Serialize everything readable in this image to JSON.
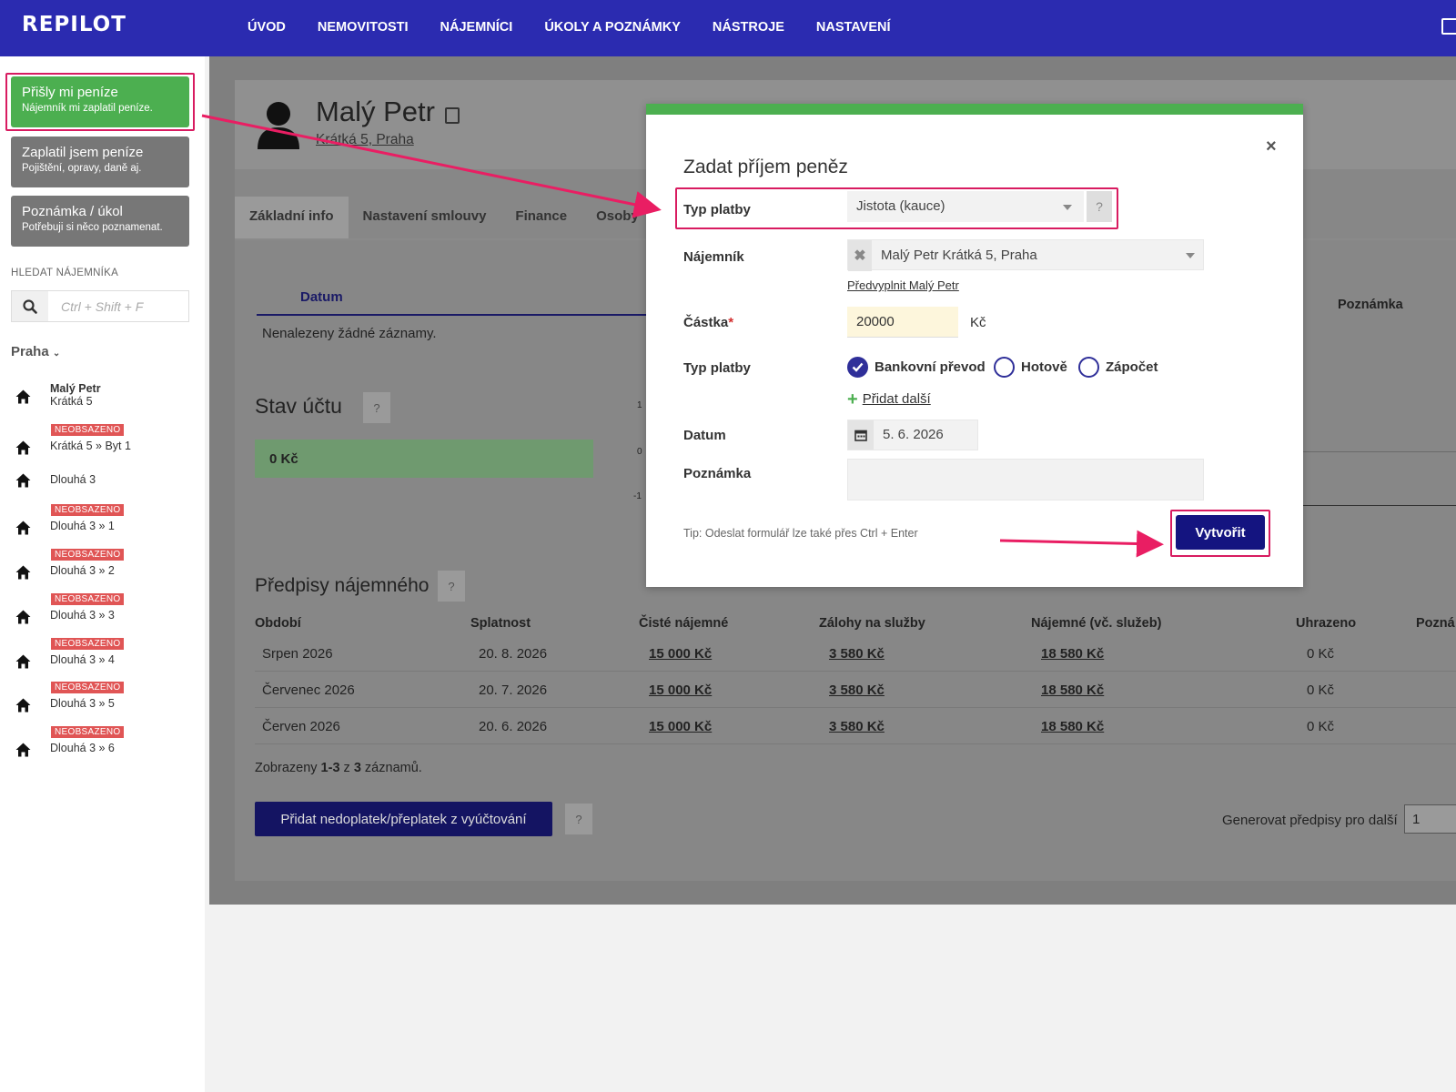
{
  "app": {
    "logo": "REPILOT",
    "nav": [
      "ÚVOD",
      "NEMOVITOSTI",
      "NÁJEMNÍCI",
      "ÚKOLY A POZNÁMKY",
      "NÁSTROJE",
      "NASTAVENÍ"
    ]
  },
  "sidebar": {
    "actions": [
      {
        "title": "Přišly mi peníze",
        "subtitle": "Nájemník mi zaplatil peníze."
      },
      {
        "title": "Zaplatil jsem peníze",
        "subtitle": "Pojištění, opravy, daně aj."
      },
      {
        "title": "Poznámka / úkol",
        "subtitle": "Potřebuji si něco poznamenat."
      }
    ],
    "search_label": "HLEDAT NÁJEMNÍKA",
    "search_placeholder": "Ctrl + Shift + F",
    "city": "Praha",
    "properties": [
      {
        "tenant": "Malý Petr",
        "name": "Krátká 5",
        "badge": ""
      },
      {
        "tenant": "",
        "name": "Krátká 5 » Byt 1",
        "badge": "NEOBSAZENO"
      },
      {
        "tenant": "",
        "name": "Dlouhá 3",
        "badge": ""
      },
      {
        "tenant": "",
        "name": "Dlouhá 3 » 1",
        "badge": "NEOBSAZENO"
      },
      {
        "tenant": "",
        "name": "Dlouhá 3 » 2",
        "badge": "NEOBSAZENO"
      },
      {
        "tenant": "",
        "name": "Dlouhá 3 » 3",
        "badge": "NEOBSAZENO"
      },
      {
        "tenant": "",
        "name": "Dlouhá 3 » 4",
        "badge": "NEOBSAZENO"
      },
      {
        "tenant": "",
        "name": "Dlouhá 3 » 5",
        "badge": "NEOBSAZENO"
      },
      {
        "tenant": "",
        "name": "Dlouhá 3 » 6",
        "badge": "NEOBSAZENO"
      }
    ]
  },
  "tenant": {
    "name": "Malý Petr",
    "address": "Krátká 5, Praha"
  },
  "tabs": [
    "Základní info",
    "Nastavení smlouvy",
    "Finance",
    "Osoby"
  ],
  "payments": {
    "date_header": "Datum",
    "note_header": "Poznámka",
    "empty": "Nenalezeny žádné záznamy."
  },
  "balance": {
    "title": "Stav účtu",
    "help": "?",
    "value": "0 Kč",
    "ticks": [
      "1",
      "0",
      "-1"
    ]
  },
  "rent": {
    "title": "Předpisy nájemného",
    "help": "?",
    "columns": [
      "Období",
      "Splatnost",
      "Čisté nájemné",
      "Zálohy na služby",
      "Nájemné (vč. služeb)",
      "Uhrazeno",
      "Pozná"
    ],
    "rows": [
      {
        "period": "Srpen 2026",
        "due": "20. 8. 2026",
        "net": "15 000 Kč",
        "services": "3 580 Kč",
        "total": "18 580 Kč",
        "paid": "0 Kč"
      },
      {
        "period": "Červenec 2026",
        "due": "20. 7. 2026",
        "net": "15 000 Kč",
        "services": "3 580 Kč",
        "total": "18 580 Kč",
        "paid": "0 Kč"
      },
      {
        "period": "Červen 2026",
        "due": "20. 6. 2026",
        "net": "15 000 Kč",
        "services": "3 580 Kč",
        "total": "18 580 Kč",
        "paid": "0 Kč"
      }
    ],
    "shown_prefix": "Zobrazeny ",
    "shown_range": "1-3",
    "shown_mid": " z ",
    "shown_total": "3",
    "shown_suffix": " záznamů.",
    "add_button": "Přidat nedoplatek/přeplatek z vyúčtování",
    "add_help": "?",
    "generate_label": "Generovat předpisy pro další",
    "generate_value": "1"
  },
  "modal": {
    "close": "×",
    "title": "Zadat příjem peněz",
    "payment_type_label": "Typ platby",
    "payment_type_value": "Jistota (kauce)",
    "payment_type_help": "?",
    "tenant_label": "Nájemník",
    "tenant_value": "Malý Petr Krátká 5, Praha",
    "tenant_clear": "✖",
    "prefill_link": "Předvyplnit Malý Petr",
    "amount_label": "Částka",
    "amount_required": "*",
    "amount_value": "20000",
    "currency": "Kč",
    "method_label": "Typ platby",
    "methods": [
      {
        "label": "Bankovní převod",
        "checked": true
      },
      {
        "label": "Hotově",
        "checked": false
      },
      {
        "label": "Zápočet",
        "checked": false
      }
    ],
    "add_more": "Přidat další",
    "date_label": "Datum",
    "date_value": "5. 6. 2026",
    "note_label": "Poznámka",
    "tip": "Tip: Odeslat formulář lze také přes Ctrl + Enter",
    "submit": "Vytvořit"
  },
  "colors": {
    "navbar": "#2b2bb0",
    "green": "#4caf50",
    "highlight": "#d81b60",
    "primary_button": "#141480",
    "badge": "#e05555"
  }
}
